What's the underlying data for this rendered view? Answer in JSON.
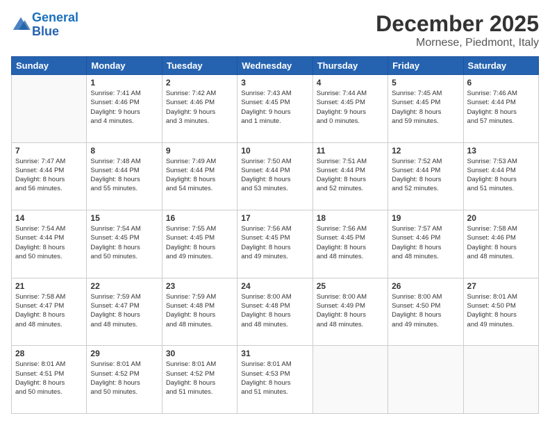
{
  "header": {
    "logo_line1": "General",
    "logo_line2": "Blue",
    "title": "December 2025",
    "location": "Mornese, Piedmont, Italy"
  },
  "days_of_week": [
    "Sunday",
    "Monday",
    "Tuesday",
    "Wednesday",
    "Thursday",
    "Friday",
    "Saturday"
  ],
  "weeks": [
    [
      {
        "day": "",
        "info": ""
      },
      {
        "day": "1",
        "info": "Sunrise: 7:41 AM\nSunset: 4:46 PM\nDaylight: 9 hours\nand 4 minutes."
      },
      {
        "day": "2",
        "info": "Sunrise: 7:42 AM\nSunset: 4:46 PM\nDaylight: 9 hours\nand 3 minutes."
      },
      {
        "day": "3",
        "info": "Sunrise: 7:43 AM\nSunset: 4:45 PM\nDaylight: 9 hours\nand 1 minute."
      },
      {
        "day": "4",
        "info": "Sunrise: 7:44 AM\nSunset: 4:45 PM\nDaylight: 9 hours\nand 0 minutes."
      },
      {
        "day": "5",
        "info": "Sunrise: 7:45 AM\nSunset: 4:45 PM\nDaylight: 8 hours\nand 59 minutes."
      },
      {
        "day": "6",
        "info": "Sunrise: 7:46 AM\nSunset: 4:44 PM\nDaylight: 8 hours\nand 57 minutes."
      }
    ],
    [
      {
        "day": "7",
        "info": "Sunrise: 7:47 AM\nSunset: 4:44 PM\nDaylight: 8 hours\nand 56 minutes."
      },
      {
        "day": "8",
        "info": "Sunrise: 7:48 AM\nSunset: 4:44 PM\nDaylight: 8 hours\nand 55 minutes."
      },
      {
        "day": "9",
        "info": "Sunrise: 7:49 AM\nSunset: 4:44 PM\nDaylight: 8 hours\nand 54 minutes."
      },
      {
        "day": "10",
        "info": "Sunrise: 7:50 AM\nSunset: 4:44 PM\nDaylight: 8 hours\nand 53 minutes."
      },
      {
        "day": "11",
        "info": "Sunrise: 7:51 AM\nSunset: 4:44 PM\nDaylight: 8 hours\nand 52 minutes."
      },
      {
        "day": "12",
        "info": "Sunrise: 7:52 AM\nSunset: 4:44 PM\nDaylight: 8 hours\nand 52 minutes."
      },
      {
        "day": "13",
        "info": "Sunrise: 7:53 AM\nSunset: 4:44 PM\nDaylight: 8 hours\nand 51 minutes."
      }
    ],
    [
      {
        "day": "14",
        "info": "Sunrise: 7:54 AM\nSunset: 4:44 PM\nDaylight: 8 hours\nand 50 minutes."
      },
      {
        "day": "15",
        "info": "Sunrise: 7:54 AM\nSunset: 4:45 PM\nDaylight: 8 hours\nand 50 minutes."
      },
      {
        "day": "16",
        "info": "Sunrise: 7:55 AM\nSunset: 4:45 PM\nDaylight: 8 hours\nand 49 minutes."
      },
      {
        "day": "17",
        "info": "Sunrise: 7:56 AM\nSunset: 4:45 PM\nDaylight: 8 hours\nand 49 minutes."
      },
      {
        "day": "18",
        "info": "Sunrise: 7:56 AM\nSunset: 4:45 PM\nDaylight: 8 hours\nand 48 minutes."
      },
      {
        "day": "19",
        "info": "Sunrise: 7:57 AM\nSunset: 4:46 PM\nDaylight: 8 hours\nand 48 minutes."
      },
      {
        "day": "20",
        "info": "Sunrise: 7:58 AM\nSunset: 4:46 PM\nDaylight: 8 hours\nand 48 minutes."
      }
    ],
    [
      {
        "day": "21",
        "info": "Sunrise: 7:58 AM\nSunset: 4:47 PM\nDaylight: 8 hours\nand 48 minutes."
      },
      {
        "day": "22",
        "info": "Sunrise: 7:59 AM\nSunset: 4:47 PM\nDaylight: 8 hours\nand 48 minutes."
      },
      {
        "day": "23",
        "info": "Sunrise: 7:59 AM\nSunset: 4:48 PM\nDaylight: 8 hours\nand 48 minutes."
      },
      {
        "day": "24",
        "info": "Sunrise: 8:00 AM\nSunset: 4:48 PM\nDaylight: 8 hours\nand 48 minutes."
      },
      {
        "day": "25",
        "info": "Sunrise: 8:00 AM\nSunset: 4:49 PM\nDaylight: 8 hours\nand 48 minutes."
      },
      {
        "day": "26",
        "info": "Sunrise: 8:00 AM\nSunset: 4:50 PM\nDaylight: 8 hours\nand 49 minutes."
      },
      {
        "day": "27",
        "info": "Sunrise: 8:01 AM\nSunset: 4:50 PM\nDaylight: 8 hours\nand 49 minutes."
      }
    ],
    [
      {
        "day": "28",
        "info": "Sunrise: 8:01 AM\nSunset: 4:51 PM\nDaylight: 8 hours\nand 50 minutes."
      },
      {
        "day": "29",
        "info": "Sunrise: 8:01 AM\nSunset: 4:52 PM\nDaylight: 8 hours\nand 50 minutes."
      },
      {
        "day": "30",
        "info": "Sunrise: 8:01 AM\nSunset: 4:52 PM\nDaylight: 8 hours\nand 51 minutes."
      },
      {
        "day": "31",
        "info": "Sunrise: 8:01 AM\nSunset: 4:53 PM\nDaylight: 8 hours\nand 51 minutes."
      },
      {
        "day": "",
        "info": ""
      },
      {
        "day": "",
        "info": ""
      },
      {
        "day": "",
        "info": ""
      }
    ]
  ]
}
